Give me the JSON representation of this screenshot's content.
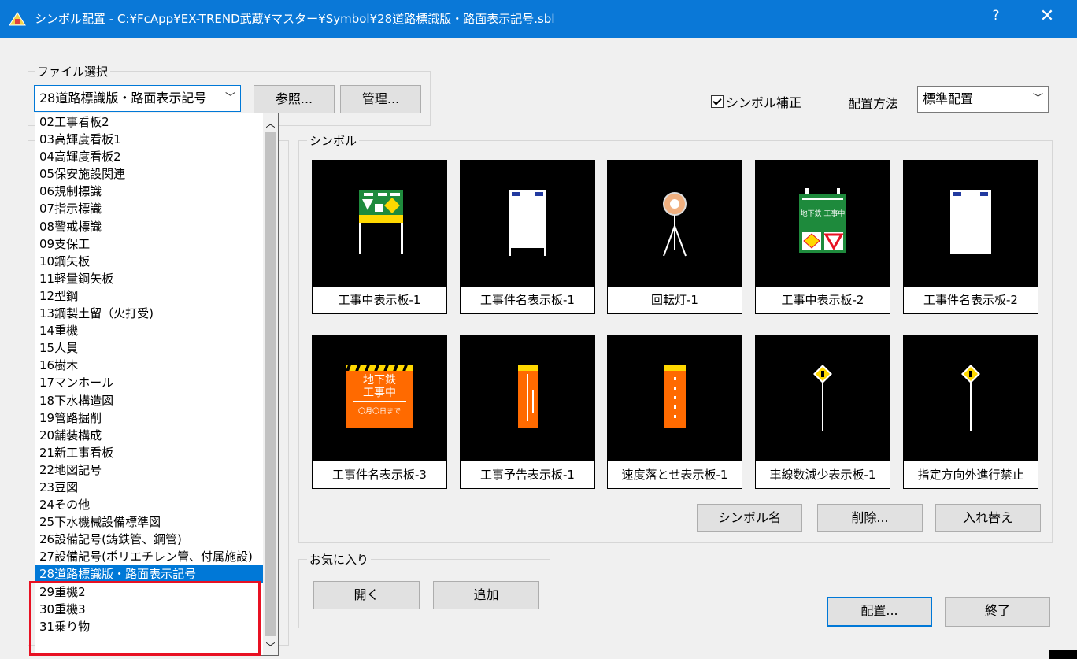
{
  "window": {
    "title": "シンボル配置 - C:¥FcApp¥EX-TREND武蔵¥マスター¥Symbol¥28道路標識版・路面表示記号.sbl",
    "help_label": "?",
    "close_label": "✕",
    "icon": "app-icon"
  },
  "file_select": {
    "group_label": "ファイル選択",
    "current": "28道路標識版・路面表示記号",
    "browse_label": "参照...",
    "manage_label": "管理...",
    "options": [
      "02工事看板2",
      "03高輝度看板1",
      "04高輝度看板2",
      "05保安施設関連",
      "06規制標識",
      "07指示標識",
      "08警戒標識",
      "09支保工",
      "10鋼矢板",
      "11軽量鋼矢板",
      "12型鋼",
      "13鋼製土留（火打受)",
      "14重機",
      "15人員",
      "16樹木",
      "17マンホール",
      "18下水構造図",
      "19管路掘削",
      "20舗装構成",
      "21新工事看板",
      "22地図記号",
      "23豆図",
      "24その他",
      "25下水機械設備標準図",
      "26設備記号(鋳鉄管、鋼管)",
      "27設備記号(ポリエチレン管、付属施設)",
      "28道路標識版・路面表示記号",
      "29重機2",
      "30重機3",
      "31乗り物"
    ],
    "selected_index": 26
  },
  "options": {
    "symbol_correction_label": "シンボル補正",
    "symbol_correction_checked": true,
    "placement_method_label": "配置方法",
    "placement_method_value": "標準配置"
  },
  "symbols": {
    "group_label": "シンボル",
    "items": [
      {
        "name": "工事中表示板-1"
      },
      {
        "name": "工事件名表示板-1"
      },
      {
        "name": "回転灯-1"
      },
      {
        "name": "工事中表示板-2"
      },
      {
        "name": "工事件名表示板-2"
      },
      {
        "name": "工事件名表示板-3"
      },
      {
        "name": "工事予告表示板-1"
      },
      {
        "name": "速度落とせ表示板-1"
      },
      {
        "name": "車線数減少表示板-1"
      },
      {
        "name": "指定方向外進行禁止"
      }
    ],
    "sign_text": {
      "chikatetsu": "地下鉄",
      "kojichu": "工事中",
      "date": "〇月〇日まで",
      "banner": "地下鉄 工事中"
    },
    "symbol_name_label": "シンボル名",
    "delete_label": "削除...",
    "swap_label": "入れ替え"
  },
  "favorites": {
    "group_label": "お気に入り",
    "open_label": "開く",
    "add_label": "追加"
  },
  "footer": {
    "place_label": "配置...",
    "exit_label": "終了"
  },
  "colors": {
    "titlebar": "#0a78d7",
    "selection": "#0078d7",
    "highlight_box": "#e81123",
    "sign_orange": "#ff6a00",
    "sign_green": "#1e8a3c",
    "sign_yellow": "#ffd800"
  }
}
